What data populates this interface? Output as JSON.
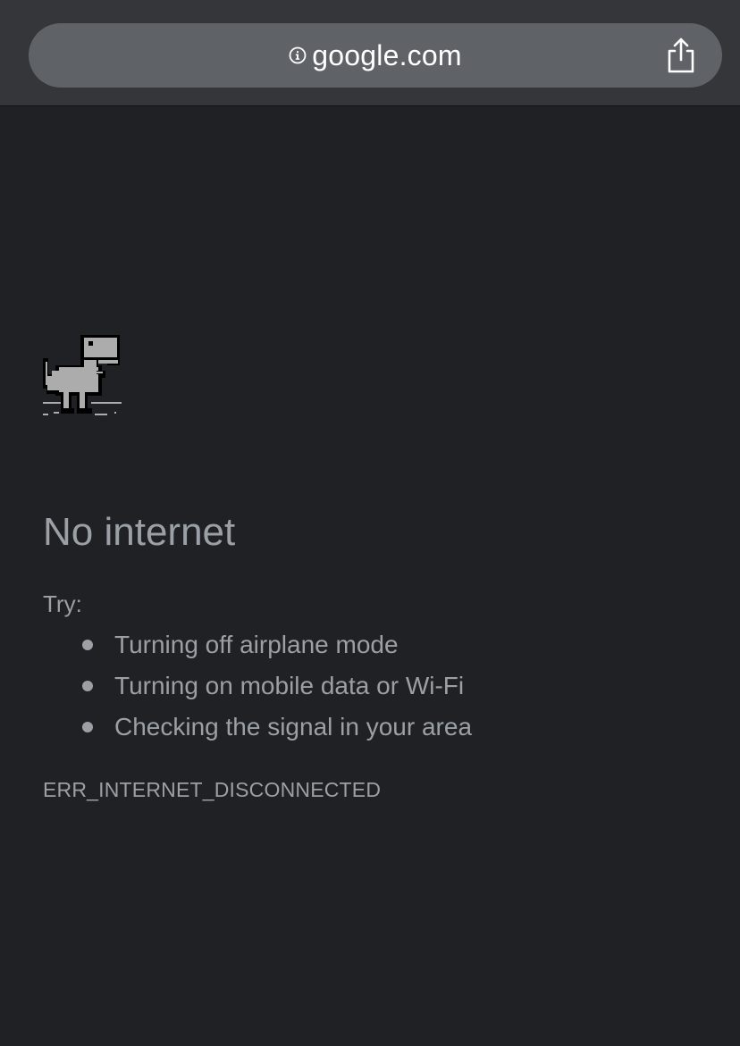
{
  "address_bar": {
    "info_icon": "info-icon",
    "url": "google.com",
    "share_icon": "share-icon"
  },
  "error_page": {
    "illustration": "offline-dino-icon",
    "title": "No internet",
    "try_label": "Try:",
    "suggestions": [
      "Turning off airplane mode",
      "Turning on mobile data or Wi-Fi",
      "Checking the signal in your area"
    ],
    "error_code": "ERR_INTERNET_DISCONNECTED"
  },
  "colors": {
    "page_background": "#202124",
    "toolbar_background": "#35363a",
    "url_pill": "#5f6368",
    "text": "#9aa0a6",
    "dino": "#acacac",
    "dino_outline": "#000000"
  }
}
